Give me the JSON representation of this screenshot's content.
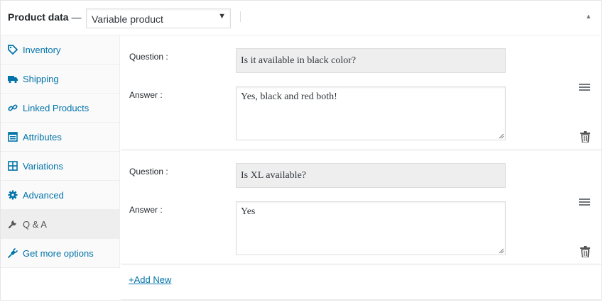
{
  "header": {
    "title": "Product data",
    "dash": "—",
    "product_type": "Variable product"
  },
  "sidebar": {
    "items": [
      {
        "label": "Inventory",
        "icon": "tag-icon"
      },
      {
        "label": "Shipping",
        "icon": "truck-icon"
      },
      {
        "label": "Linked Products",
        "icon": "link-icon"
      },
      {
        "label": "Attributes",
        "icon": "list-icon"
      },
      {
        "label": "Variations",
        "icon": "grid-icon"
      },
      {
        "label": "Advanced",
        "icon": "gear-icon"
      },
      {
        "label": "Q & A",
        "icon": "wrench-icon",
        "active": true
      },
      {
        "label": "Get more options",
        "icon": "plugin-icon"
      }
    ]
  },
  "qa": {
    "question_label": "Question :",
    "answer_label": "Answer :",
    "entries": [
      {
        "question": "Is it available in black color?",
        "answer": "Yes, black and red both!"
      },
      {
        "question": "Is XL available?",
        "answer": "Yes"
      }
    ],
    "add_new": "+Add New"
  },
  "colors": {
    "accent": "#0073aa",
    "active_tab_bg": "#eeeeee",
    "readonly_bg": "#eeeeee"
  }
}
